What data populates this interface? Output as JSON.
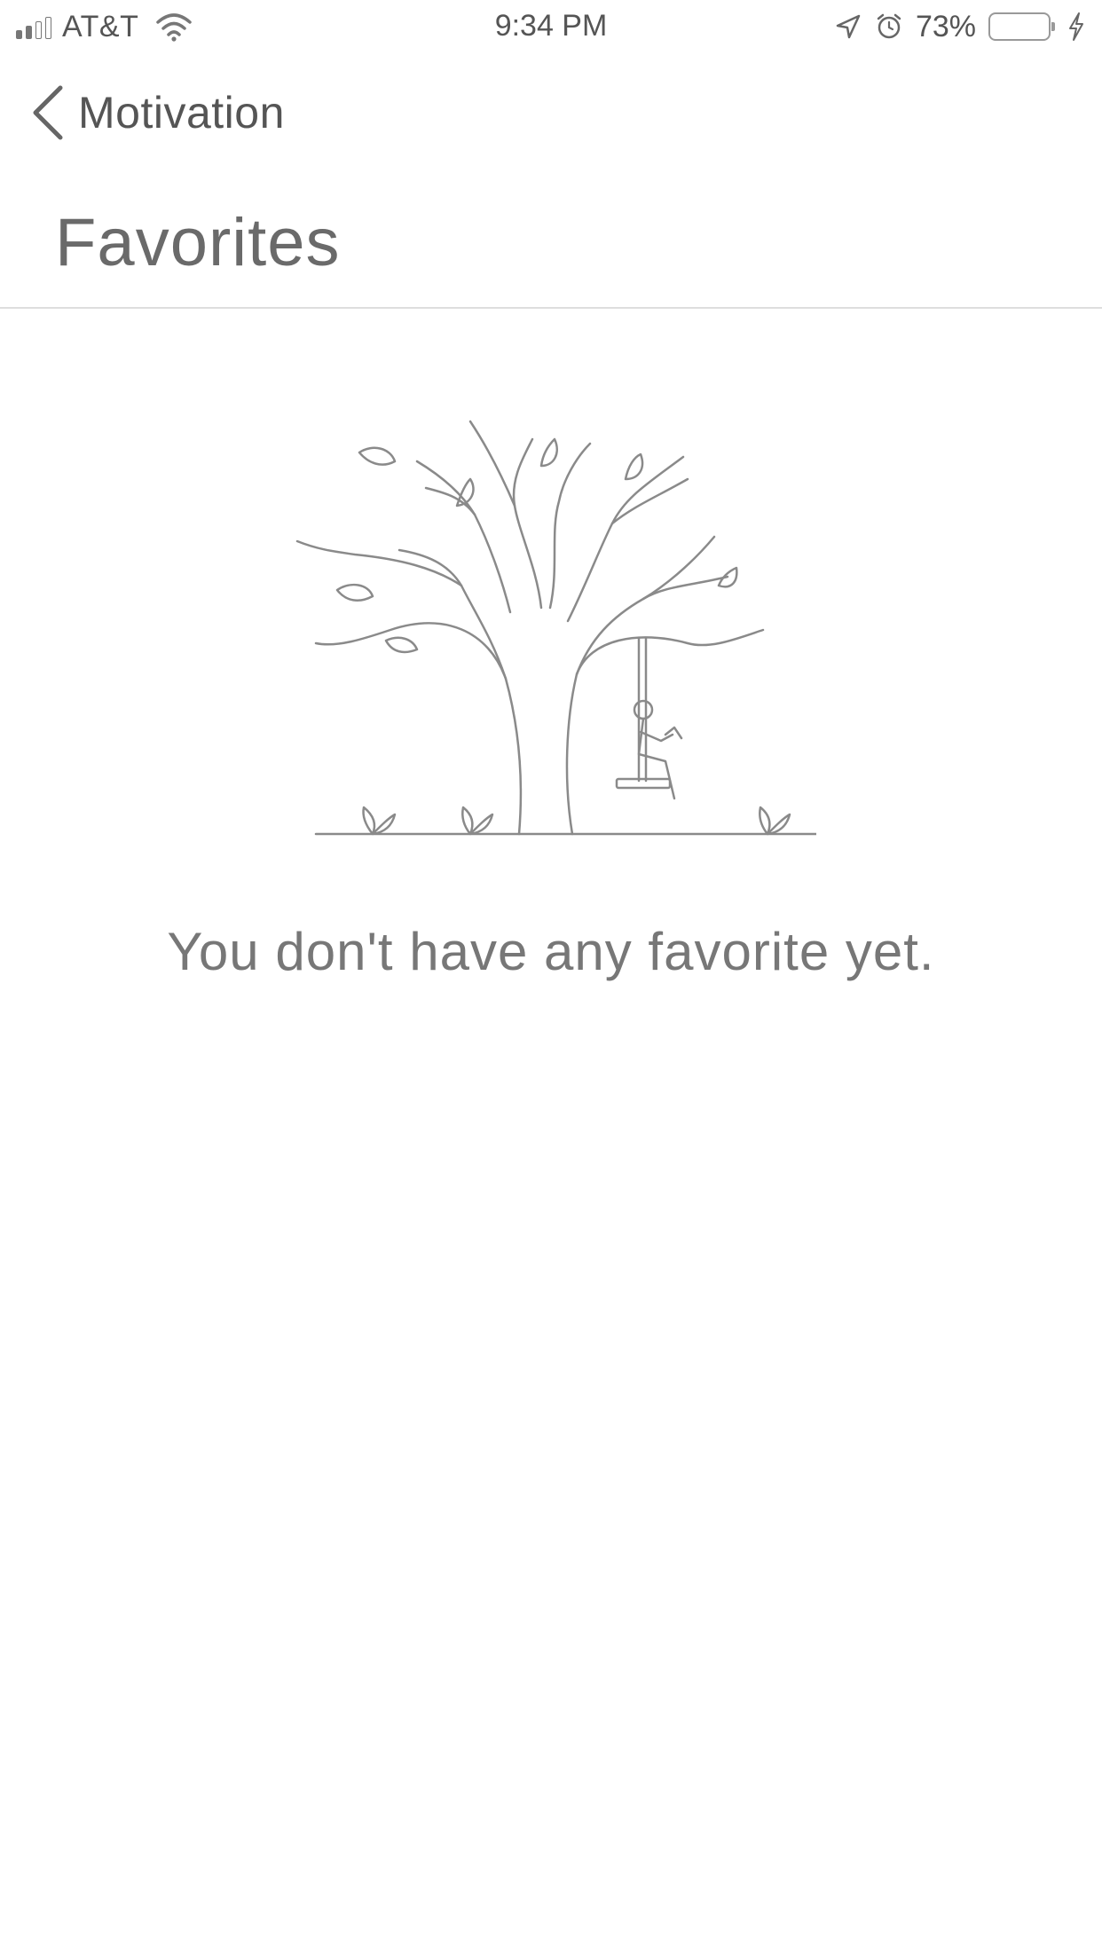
{
  "status_bar": {
    "carrier": "AT&T",
    "time": "9:34 PM",
    "battery_percent": "73%",
    "signal_bars_filled": 2,
    "signal_bars_total": 4,
    "icons": [
      "signal-icon",
      "wifi-icon",
      "location-arrow-icon",
      "alarm-icon",
      "battery-icon",
      "charging-bolt-icon"
    ]
  },
  "nav": {
    "back_label": "Motivation",
    "back_icon": "chevron-left-icon"
  },
  "page": {
    "title": "Favorites"
  },
  "empty_state": {
    "illustration": "tree-swing-illustration",
    "message": "You don't have any favorite yet."
  },
  "colors": {
    "text": "#555555",
    "divider": "#dedede",
    "background": "#ffffff"
  }
}
